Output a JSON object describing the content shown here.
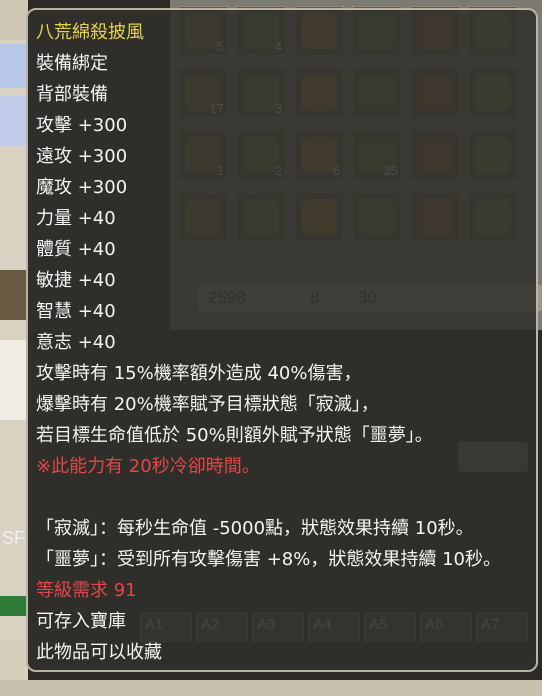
{
  "tooltip": {
    "item_name": "八荒綿殺披風",
    "bind_status": "裝備綁定",
    "slot": "背部裝備",
    "stats": [
      "攻擊 +300",
      "遠攻 +300",
      "魔攻 +300",
      "力量 +40",
      "體質 +40",
      "敏捷 +40",
      "智慧 +40",
      "意志 +40"
    ],
    "effect_lines": [
      "攻擊時有 15%機率額外造成 40%傷害，",
      "爆擊時有 20%機率賦予目標狀態「寂滅」，",
      "若目標生命值低於 50%則額外賦予狀態「噩夢」。"
    ],
    "cooldown_note": "※此能力有 20秒冷卻時間。",
    "status_defs": [
      "「寂滅」：每秒生命值 -5000點，狀態效果持續 10秒。",
      "「噩夢」：受到所有攻擊傷害 +8%，狀態效果持續 10秒。"
    ],
    "level_requirement": "等級需求 91",
    "storable": "可存入寶庫",
    "collectible": "此物品可以收藏"
  },
  "inventory": {
    "slot_counts": [
      "5",
      "4",
      "",
      "",
      "",
      "",
      "17",
      "3",
      "",
      "",
      "",
      "",
      "1",
      "2",
      "6",
      "35",
      "",
      "",
      "",
      "",
      "",
      "",
      "",
      ""
    ],
    "stats_bar": [
      "2598",
      "8",
      "30"
    ],
    "bottom_slots": [
      "A1",
      "A2",
      "A3",
      "A4",
      "A5",
      "A6",
      "A7"
    ]
  },
  "side_label": "SF",
  "colors": {
    "item_name": "#e6d24d",
    "normal_text": "#f4f4f4",
    "warning_red": "#e04848",
    "level_req": "#e8d45a",
    "tooltip_bg": "#302f2b",
    "tooltip_border": "#b9b4a6"
  }
}
